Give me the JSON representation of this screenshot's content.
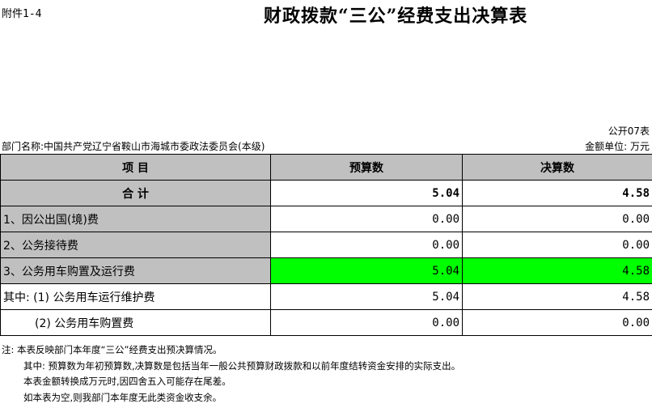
{
  "header": {
    "attachment": "附件1-4",
    "title": "财政拨款“三公”经费支出决算表",
    "table_code": "公开07表",
    "department": "部门名称:中国共产党辽宁省鞍山市海城市委政法委员会(本级)",
    "unit": "金额单位: 万元"
  },
  "table": {
    "columns": [
      "项    目",
      "预算数",
      "决算数"
    ],
    "rows": [
      {
        "label": "合    计",
        "budget": "5.04",
        "actual": "4.58"
      },
      {
        "label": "1、因公出国(境)费",
        "budget": "0.00",
        "actual": "0.00"
      },
      {
        "label": "2、公务接待费",
        "budget": "0.00",
        "actual": "0.00"
      },
      {
        "label": "3、公务用车购置及运行费",
        "budget": "5.04",
        "actual": "4.58"
      },
      {
        "label": "其中: (1) 公务用车运行维护费",
        "budget": "5.04",
        "actual": "4.58"
      },
      {
        "label": "(2) 公务用车购置费",
        "budget": "0.00",
        "actual": "0.00"
      }
    ]
  },
  "notes": [
    "注: 本表反映部门本年度“三公”经费支出预决算情况。",
    "其中: 预算数为年初预算数,决算数是包括当年一般公共预算财政拨款和以前年度结转资金安排的实际支出。",
    "本表金额转换成万元时,因四舍五入可能存在尾差。",
    "如本表为空,则我部门本年度无此类资金收支余。"
  ],
  "colors": {
    "header_gray": "#c0c0c0",
    "highlight_green": "#00ff00"
  }
}
